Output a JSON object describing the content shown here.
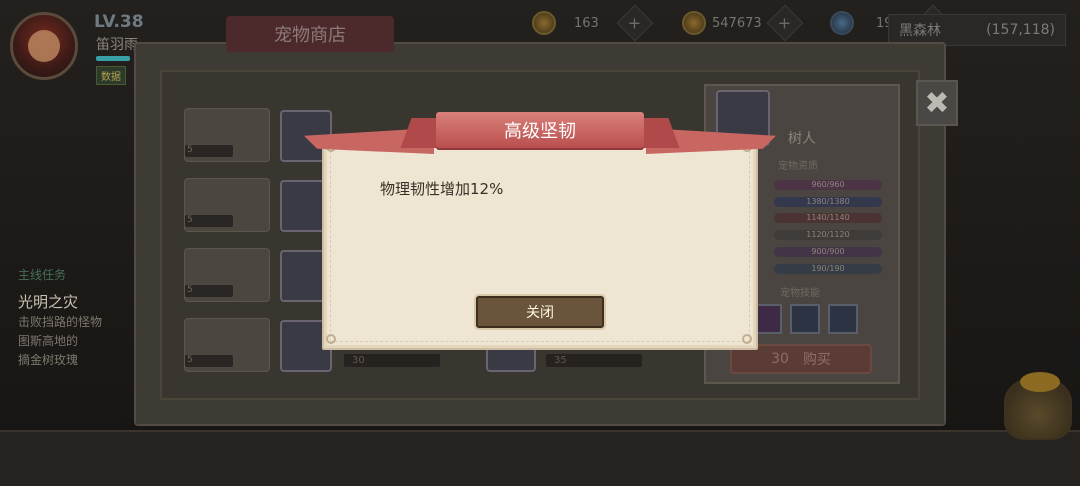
{
  "hud": {
    "level": "LV.38",
    "player_name": "笛羽雨",
    "rank_badge": "数据",
    "currency": [
      {
        "icon": "gold-coin-icon",
        "value": "163"
      },
      {
        "icon": "gold-coin-icon",
        "value": "547673"
      },
      {
        "icon": "blue-gem-icon",
        "value": "19"
      }
    ],
    "coords": {
      "label": "黑森林",
      "value": "(157,118)"
    }
  },
  "quest": {
    "header": "主线任务",
    "name": "光明之灾",
    "description_lines": [
      "击败挡路的怪物",
      "图斯高地的",
      "摘金树玫瑰"
    ]
  },
  "shop": {
    "title": "宠物商店",
    "slot_values": [
      "5",
      "5",
      "5",
      "5"
    ],
    "pet_prices": [
      "30",
      "35"
    ],
    "detail": {
      "pet_name": "树人",
      "section_attrs": "宠物资质",
      "stats": [
        "960/960",
        "1380/1380",
        "1140/1140",
        "1120/1120",
        "900/900",
        "190/190"
      ],
      "section_skills": "宠物技能",
      "buy_price": "30",
      "buy_label": "购买"
    },
    "close_symbol": "✖"
  },
  "dialog": {
    "title": "高级坚韧",
    "description": "物理韧性增加12%",
    "close_button": "关闭"
  },
  "colors": {
    "ribbon": "#c45a57",
    "dialog_bg": "#efe5d3",
    "button_bg": "#6a543c",
    "text_dark": "#3a2f26"
  }
}
